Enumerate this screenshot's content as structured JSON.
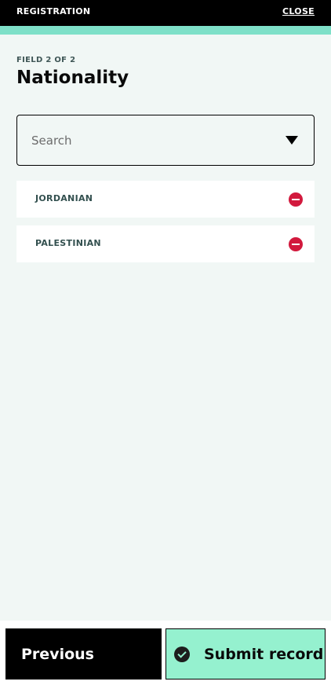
{
  "header": {
    "title": "REGISTRATION",
    "close_label": "CLOSE"
  },
  "progress": {
    "fraction": 1.0
  },
  "field": {
    "step": "FIELD 2 OF 2",
    "title": "Nationality"
  },
  "search": {
    "placeholder": "Search",
    "value": ""
  },
  "selected_items": [
    {
      "label": "JORDANIAN"
    },
    {
      "label": "PALESTINIAN"
    }
  ],
  "footer": {
    "previous_label": "Previous",
    "submit_label": "Submit record"
  },
  "colors": {
    "accent": "#95f1cf",
    "progress": "#7ee0c8",
    "remove": "#d2193d",
    "background": "#f1f7f5"
  },
  "icons": {
    "dropdown": "caret-down-icon",
    "remove": "minus-circle-icon",
    "submit": "check-circle-icon"
  }
}
